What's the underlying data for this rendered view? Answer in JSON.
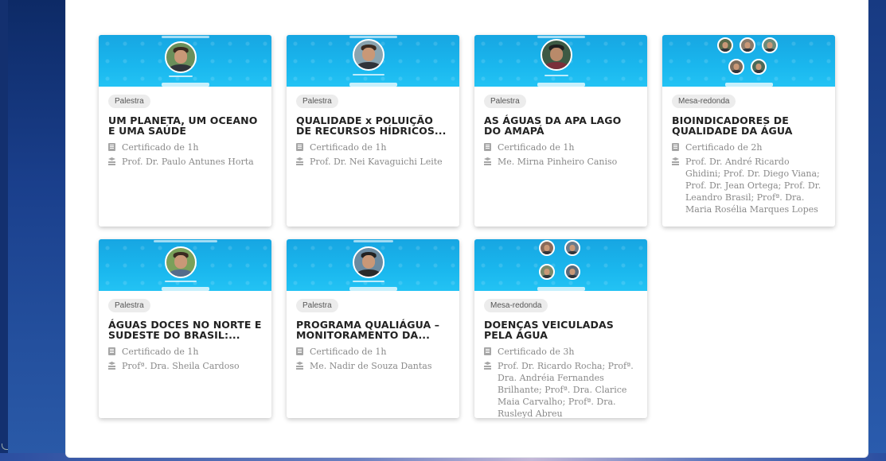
{
  "cards": [
    {
      "badge": "Palestra",
      "title": "UM PLANETA, UM OCEANO E UMA SAÚDE",
      "cert": "Certificado de 1h",
      "speakers": "Prof. Dr. Paulo Antunes Horta"
    },
    {
      "badge": "Palestra",
      "title": "QUALIDADE x POLUIÇÃO DE RECURSOS HÍDRICOS...",
      "cert": "Certificado de 1h",
      "speakers": "Prof. Dr. Nei Kavaguichi Leite"
    },
    {
      "badge": "Palestra",
      "title": "AS ÁGUAS DA APA LAGO DO AMAPÁ",
      "cert": "Certificado de 1h",
      "speakers": "Me. Mirna Pinheiro Caniso"
    },
    {
      "badge": "Mesa-redonda",
      "title": "BIOINDICADORES DE QUALIDADE DA ÁGUA",
      "cert": "Certificado de 2h",
      "speakers": "Prof. Dr. André Ricardo Ghidini; Prof. Dr. Diego Viana; Prof. Dr. Jean Ortega; Prof. Dr. Leandro Brasil; Profª. Dra. Maria Rosélia Marques Lopes"
    },
    {
      "badge": "Palestra",
      "title": "ÁGUAS DOCES NO NORTE E SUDESTE DO BRASIL:...",
      "cert": "Certificado de 1h",
      "speakers": "Profª. Dra. Sheila Cardoso"
    },
    {
      "badge": "Palestra",
      "title": "PROGRAMA QUALIÁGUA – MONITORAMENTO DA...",
      "cert": "Certificado de 1h",
      "speakers": "Me. Nadir de Souza Dantas"
    },
    {
      "badge": "Mesa-redonda",
      "title": "DOENÇAS VEICULADAS PELA ÁGUA",
      "cert": "Certificado de 3h",
      "speakers": "Prof. Dr. Ricardo Rocha; Profª. Dra. Andréia Fernandes Brilhante; Profª. Dra. Clarice Maia Carvalho; Profª. Dra. Rusleyd Abreu"
    }
  ],
  "icons": {
    "certificate": "certificate-icon",
    "speaker": "graduation-cap-icon"
  },
  "colors": {
    "thumb": "#1ab7ee",
    "badge_bg": "#ececec",
    "title": "#222222",
    "meta": "#8a8a8a"
  }
}
